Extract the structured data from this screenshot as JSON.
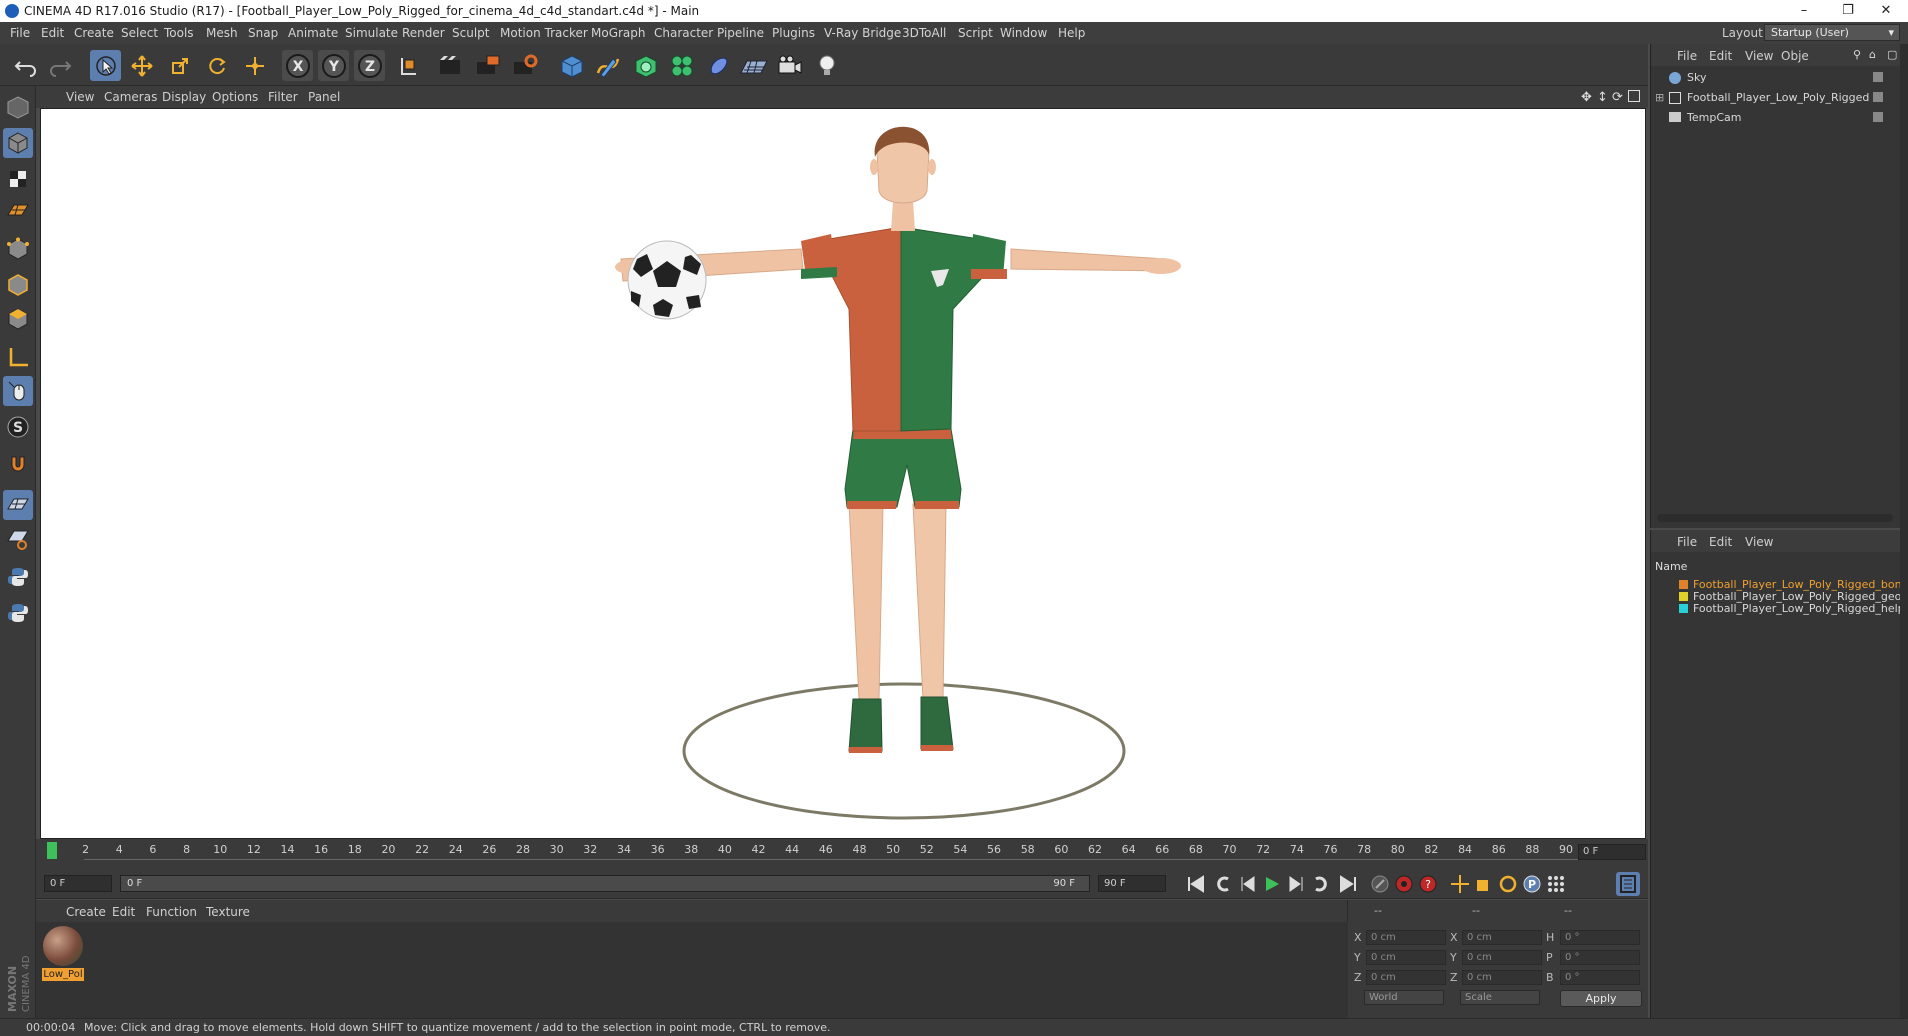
{
  "window": {
    "title": "CINEMA 4D R17.016 Studio (R17) - [Football_Player_Low_Poly_Rigged_for_cinema_4d_c4d_standart.c4d *] - Main",
    "minimize_icon": "minimize-icon",
    "restore_icon": "restore-icon",
    "close_icon": "close-icon"
  },
  "menu": {
    "items": [
      "File",
      "Edit",
      "Create",
      "Select",
      "Tools",
      "Mesh",
      "Snap",
      "Animate",
      "Simulate",
      "Render",
      "Sculpt",
      "Motion Tracker",
      "MoGraph",
      "Character",
      "Pipeline",
      "Plugins",
      "V-Ray Bridge",
      "3DToAll",
      "Script",
      "Window",
      "Help"
    ],
    "layout_label": "Layout:",
    "layout_value": "Startup (User)"
  },
  "toolbar": {
    "icons": [
      "undo-icon",
      "redo-icon",
      "live-selection-icon",
      "move-icon",
      "scale-icon",
      "rotate-icon",
      "transform-icon",
      "x-axis-icon",
      "y-axis-icon",
      "z-axis-icon",
      "world-coordinates-icon",
      "render-view-icon",
      "render-picture-viewer-icon",
      "edit-render-settings-icon",
      "cube-icon",
      "pen-spline-icon",
      "subdivision-icon",
      "cloner-icon",
      "deformer-icon",
      "floor-icon",
      "camera-icon",
      "light-icon"
    ],
    "axis_labels": [
      "X",
      "Y",
      "Z"
    ]
  },
  "left_toolbar": {
    "icons": [
      "make-editable-icon",
      "model-mode-icon",
      "texture-mode-icon",
      "workplane-mode-icon",
      "points-mode-icon",
      "edges-mode-icon",
      "polygons-mode-icon",
      "axis-mode-icon",
      "tweak-mode-icon",
      "solo-icon",
      "snap-magnet-icon",
      "enable-snap-icon",
      "quantize-icon",
      "python-icon",
      "python-script-icon"
    ],
    "solo_label": "S"
  },
  "viewport": {
    "menu": [
      "View",
      "Cameras",
      "Display",
      "Options",
      "Filter",
      "Panel"
    ],
    "nav_icons": [
      "move-view-icon",
      "zoom-view-icon",
      "rotate-view-icon",
      "toggle-layout-icon"
    ]
  },
  "timeline": {
    "ticks": [
      "0",
      "2",
      "4",
      "6",
      "8",
      "10",
      "12",
      "14",
      "16",
      "18",
      "20",
      "22",
      "24",
      "26",
      "28",
      "30",
      "32",
      "34",
      "36",
      "38",
      "40",
      "42",
      "44",
      "46",
      "48",
      "50",
      "52",
      "54",
      "56",
      "58",
      "60",
      "62",
      "64",
      "66",
      "68",
      "70",
      "72",
      "74",
      "76",
      "78",
      "80",
      "82",
      "84",
      "86",
      "88",
      "90"
    ],
    "current_frame": "0 F",
    "start_frame": "0 F",
    "range_start": "0 F",
    "range_end": "90 F",
    "end_frame": "90 F",
    "playhead": 0
  },
  "material_manager": {
    "menu": [
      "Create",
      "Edit",
      "Function",
      "Texture"
    ],
    "materials": [
      {
        "name": "Low_Pol"
      }
    ]
  },
  "coordinates": {
    "headers": [
      "--",
      "--",
      "--"
    ],
    "rows": [
      {
        "axis": "X",
        "pos": "0 cm",
        "axis2": "X",
        "size": "0 cm",
        "rot_axis": "H",
        "rot": "0 °"
      },
      {
        "axis": "Y",
        "pos": "0 cm",
        "axis2": "Y",
        "size": "0 cm",
        "rot_axis": "P",
        "rot": "0 °"
      },
      {
        "axis": "Z",
        "pos": "0 cm",
        "axis2": "Z",
        "size": "0 cm",
        "rot_axis": "B",
        "rot": "0 °"
      }
    ],
    "space": "World",
    "mode": "Scale",
    "apply_label": "Apply"
  },
  "object_manager": {
    "menu": [
      "File",
      "Edit",
      "View",
      "Obje"
    ],
    "objects": [
      {
        "name": "Sky",
        "icon": "sky-icon"
      },
      {
        "name": "Football_Player_Low_Poly_Rigged",
        "icon": "null-object-icon"
      },
      {
        "name": "TempCam",
        "icon": "camera-object-icon"
      }
    ]
  },
  "layer_manager": {
    "menu": [
      "File",
      "Edit",
      "View"
    ],
    "column_name": "Name",
    "layers": [
      {
        "name": "Football_Player_Low_Poly_Rigged_bone",
        "color": "#e0822a",
        "active": true
      },
      {
        "name": "Football_Player_Low_Poly_Rigged_geom",
        "color": "#e0d02a",
        "active": false
      },
      {
        "name": "Football_Player_Low_Poly_Rigged_helpe",
        "color": "#2ad0d8",
        "active": false
      }
    ]
  },
  "status": {
    "time": "00:00:04",
    "message": "Move: Click and drag to move elements. Hold down SHIFT to quantize movement / add to the selection in point mode, CTRL to remove."
  },
  "brand": {
    "vertical_text": "MAXON CINEMA 4D"
  },
  "colors": {
    "accent": "#5d7fb0",
    "playhead": "#3ec05a",
    "selected_layer_text": "#f0a030",
    "shirt_orange": "#c9613f",
    "shirt_green": "#2f7a45"
  }
}
